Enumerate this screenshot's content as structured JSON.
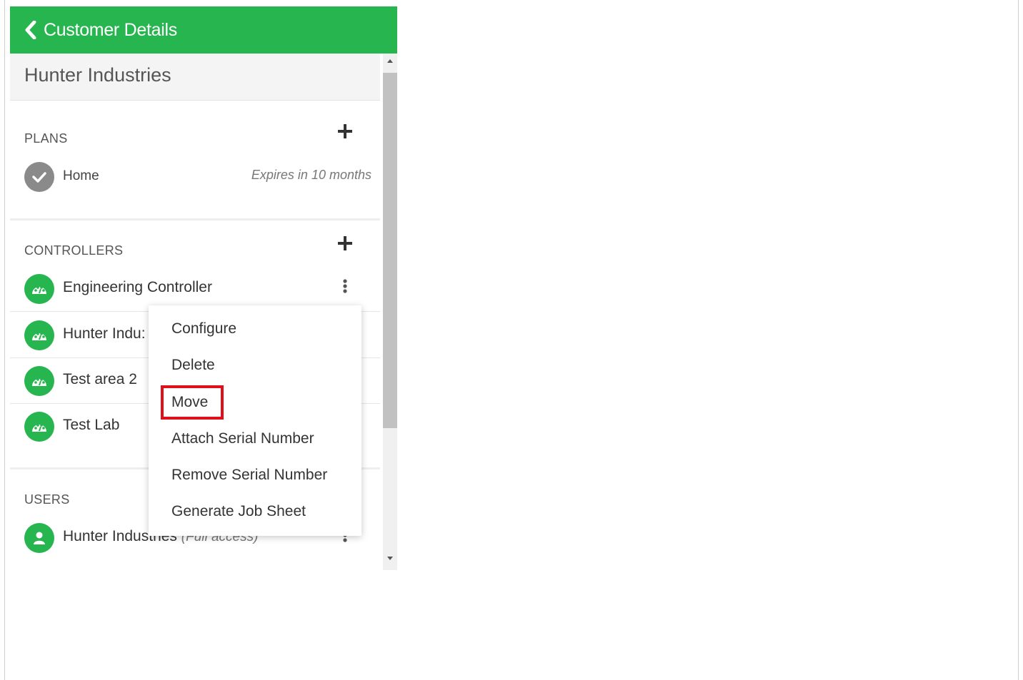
{
  "header": {
    "title": "Customer Details",
    "back_icon": "chevron-left-icon"
  },
  "customer": {
    "name": "Hunter Industries"
  },
  "plans": {
    "title": "PLANS",
    "items": [
      {
        "name": "Home",
        "expires": "Expires in 10 months",
        "status_icon": "check-icon"
      }
    ]
  },
  "controllers": {
    "title": "CONTROLLERS",
    "items": [
      {
        "name": "Engineering Controller",
        "icon": "gauge-icon"
      },
      {
        "name": "Hunter Indu:",
        "icon": "gauge-icon"
      },
      {
        "name": "Test area 2",
        "icon": "gauge-icon"
      },
      {
        "name": "Test Lab",
        "icon": "gauge-icon"
      }
    ]
  },
  "users": {
    "title": "USERS",
    "items": [
      {
        "name": "Hunter Industries",
        "access": "(Full access)",
        "icon": "user-icon"
      }
    ]
  },
  "context_menu": {
    "items": [
      "Configure",
      "Delete",
      "Move",
      "Attach Serial Number",
      "Remove Serial Number",
      "Generate Job Sheet"
    ],
    "highlighted": "Move"
  },
  "colors": {
    "brand_green": "#27b54f",
    "highlight_red": "#e0101a",
    "grey_icon": "#8a8a8a"
  }
}
